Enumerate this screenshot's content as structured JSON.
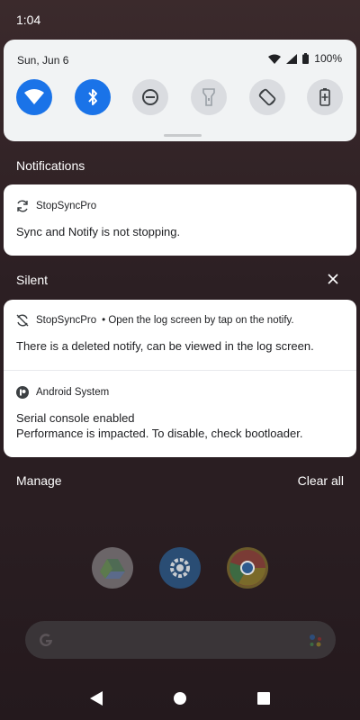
{
  "status_bar": {
    "time": "1:04"
  },
  "quick_settings": {
    "date": "Sun, Jun 6",
    "battery": "100%",
    "tiles": [
      {
        "name": "wifi",
        "state": "on"
      },
      {
        "name": "bluetooth",
        "state": "on"
      },
      {
        "name": "do-not-disturb",
        "state": "off"
      },
      {
        "name": "flashlight",
        "state": "off"
      },
      {
        "name": "auto-rotate",
        "state": "off"
      },
      {
        "name": "battery-saver",
        "state": "off"
      }
    ]
  },
  "sections": {
    "notifications": "Notifications",
    "silent": "Silent"
  },
  "notifications": [
    {
      "app": "StopSyncPro",
      "sub": "",
      "body": "Sync and Notify is not stopping."
    },
    {
      "app": "StopSyncPro",
      "sub": "• Open the log screen by tap on the notify.",
      "body": "There is a deleted notify, can be viewed in the log screen."
    },
    {
      "app": "Android System",
      "sub": "",
      "body_line1": "Serial console enabled",
      "body_line2": "Performance is impacted. To disable, check bootloader."
    }
  ],
  "actions": {
    "manage": "Manage",
    "clear_all": "Clear all"
  },
  "colors": {
    "accent": "#1a73e8",
    "tile_off": "#dadce0",
    "panel": "#f1f3f4"
  }
}
